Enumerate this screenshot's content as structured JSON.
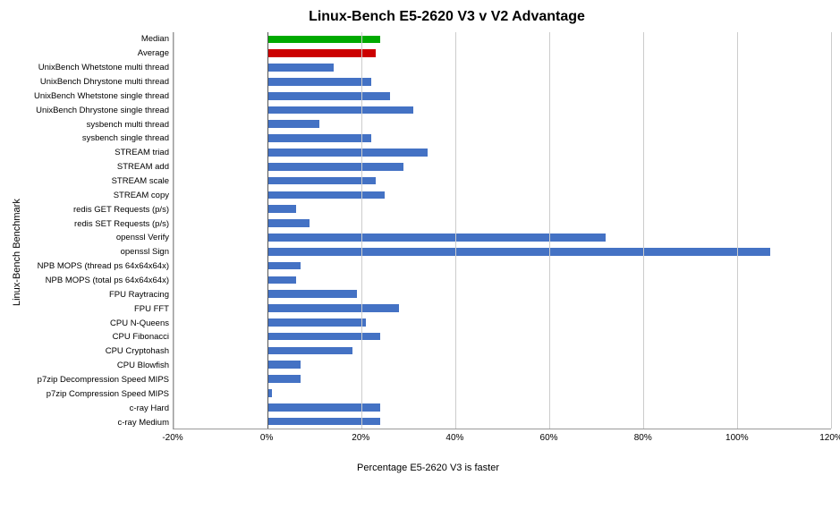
{
  "title": "Linux-Bench E5-2620 V3 v V2 Advantage",
  "yAxisLabel": "Linux-Bench Benchmark",
  "xAxisTitle": "Percentage E5-2620 V3 is faster",
  "xTicks": [
    {
      "label": "-20%",
      "pct": 0
    },
    {
      "label": "0%",
      "pct": 25
    },
    {
      "label": "20%",
      "pct": 50
    },
    {
      "label": "40%",
      "pct": 62.5
    },
    {
      "label": "60%",
      "pct": 75
    },
    {
      "label": "80%",
      "pct": 87.5
    },
    {
      "label": "100%",
      "pct": 100
    },
    {
      "label": "120%",
      "pct": 112.5
    }
  ],
  "domainMin": -20,
  "domainMax": 120,
  "rows": [
    {
      "label": "Median",
      "value": 24,
      "color": "#00aa00"
    },
    {
      "label": "Average",
      "value": 23,
      "color": "#cc0000"
    },
    {
      "label": "UnixBench Whetstone multi thread",
      "value": 14,
      "color": "#4472c4"
    },
    {
      "label": "UnixBench Dhrystone multi thread",
      "value": 22,
      "color": "#4472c4"
    },
    {
      "label": "UnixBench Whetstone single thread",
      "value": 26,
      "color": "#4472c4"
    },
    {
      "label": "UnixBench Dhrystone single thread",
      "value": 31,
      "color": "#4472c4"
    },
    {
      "label": "sysbench multi thread",
      "value": 11,
      "color": "#4472c4"
    },
    {
      "label": "sysbench single thread",
      "value": 22,
      "color": "#4472c4"
    },
    {
      "label": "STREAM triad",
      "value": 34,
      "color": "#4472c4"
    },
    {
      "label": "STREAM add",
      "value": 29,
      "color": "#4472c4"
    },
    {
      "label": "STREAM scale",
      "value": 23,
      "color": "#4472c4"
    },
    {
      "label": "STREAM copy",
      "value": 25,
      "color": "#4472c4"
    },
    {
      "label": "redis GET Requests (p/s)",
      "value": 6,
      "color": "#4472c4"
    },
    {
      "label": "redis SET Requests (p/s)",
      "value": 9,
      "color": "#4472c4"
    },
    {
      "label": "openssl Verify",
      "value": 72,
      "color": "#4472c4"
    },
    {
      "label": "openssl Sign",
      "value": 107,
      "color": "#4472c4"
    },
    {
      "label": "NPB MOPS (thread ps 64x64x64x)",
      "value": 7,
      "color": "#4472c4"
    },
    {
      "label": "NPB MOPS (total ps 64x64x64x)",
      "value": 6,
      "color": "#4472c4"
    },
    {
      "label": "FPU Raytracing",
      "value": 19,
      "color": "#4472c4"
    },
    {
      "label": "FPU FFT",
      "value": 28,
      "color": "#4472c4"
    },
    {
      "label": "CPU N-Queens",
      "value": 21,
      "color": "#4472c4"
    },
    {
      "label": "CPU Fibonacci",
      "value": 24,
      "color": "#4472c4"
    },
    {
      "label": "CPU Cryptohash",
      "value": 18,
      "color": "#4472c4"
    },
    {
      "label": "CPU Blowfish",
      "value": 7,
      "color": "#4472c4"
    },
    {
      "label": "p7zip Decompression Speed MIPS",
      "value": 7,
      "color": "#4472c4"
    },
    {
      "label": "p7zip Compression Speed MIPS",
      "value": 1,
      "color": "#4472c4"
    },
    {
      "label": "c-ray Hard",
      "value": 24,
      "color": "#4472c4"
    },
    {
      "label": "c-ray Medium",
      "value": 24,
      "color": "#4472c4"
    }
  ]
}
